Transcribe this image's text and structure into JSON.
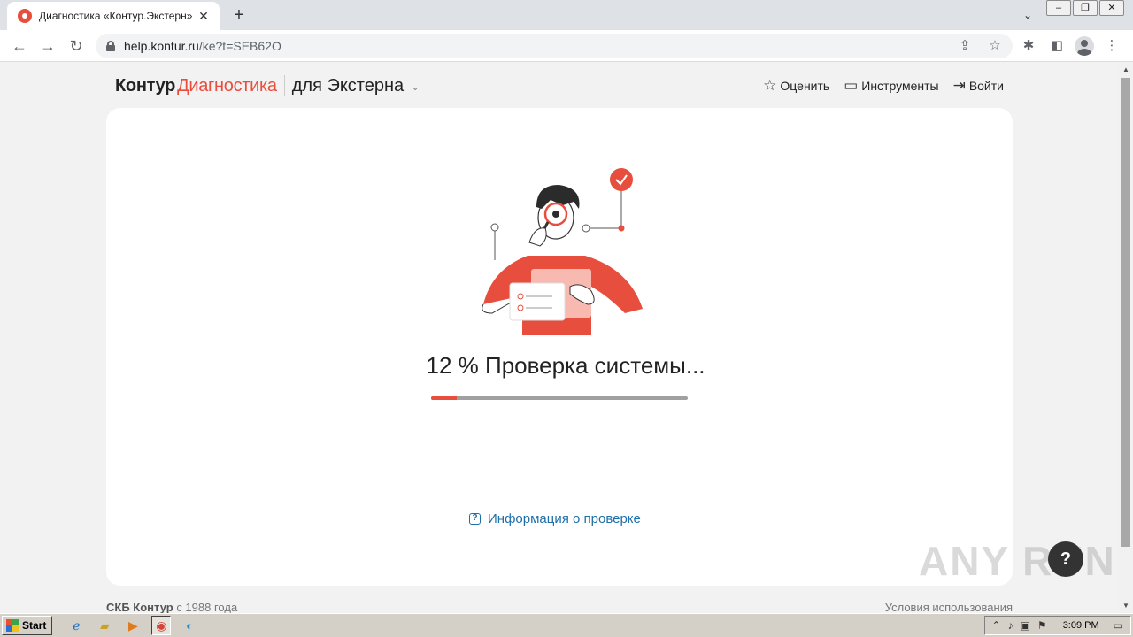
{
  "browser": {
    "tab_title": "Диагностика «Контур.Экстерн»",
    "tab_close": "✕",
    "new_tab": "+",
    "tab_menu": "⌄",
    "url_host": "help.kontur.ru",
    "url_path": "/ke?t=SEB62O"
  },
  "site": {
    "logo": "Контур",
    "logo_accent": "Диагностика",
    "product": "для Экстерна",
    "actions": {
      "rate": "Оценить",
      "tools": "Инструменты",
      "login": "Войти"
    }
  },
  "check": {
    "percent": "12",
    "percent_sign": "%",
    "status": "Проверка системы...",
    "progress_fraction": 0.1,
    "info_link": "Информация о проверке"
  },
  "footer": {
    "company": "СКБ Контур",
    "since": " с 1988 года",
    "terms": "Условия использования"
  },
  "help_fab": "?",
  "watermark": "ANY RUN",
  "taskbar": {
    "start": "Start",
    "time": "3:09 PM"
  },
  "colors": {
    "accent": "#e84e3d",
    "link": "#1f6fa8"
  }
}
